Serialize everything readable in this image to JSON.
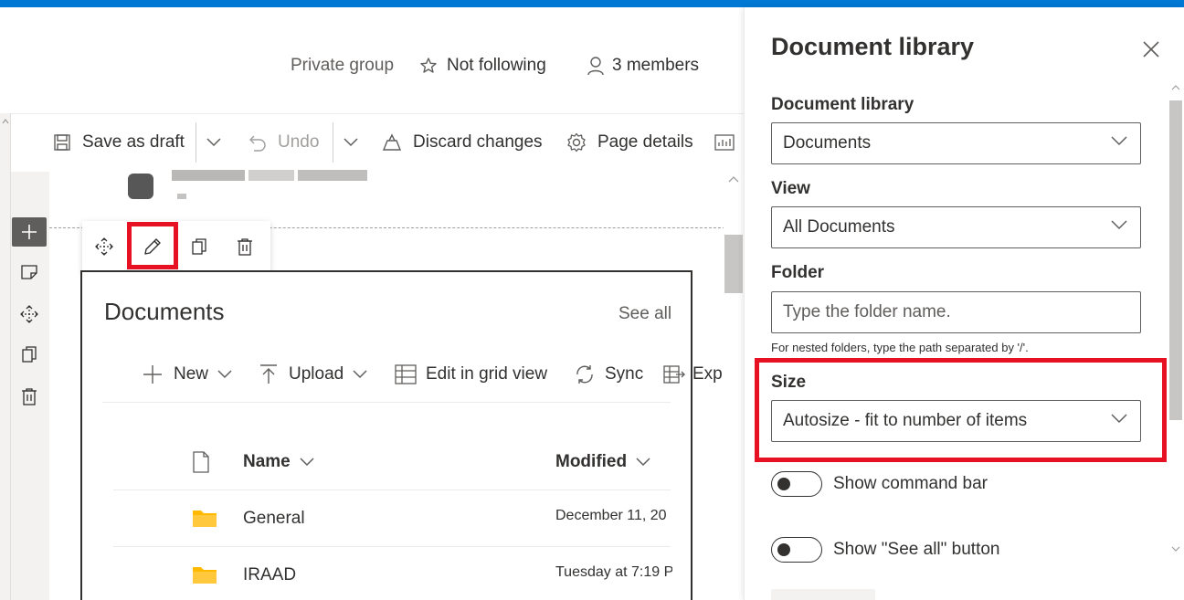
{
  "header": {
    "privacy": "Private group",
    "follow": "Not following",
    "members": "3 members"
  },
  "toolbar": {
    "save_draft": "Save as draft",
    "undo": "Undo",
    "discard": "Discard changes",
    "page_details": "Page details"
  },
  "webpart": {
    "title": "Documents",
    "see_all": "See all",
    "commands": {
      "new": "New",
      "upload": "Upload",
      "edit_grid": "Edit in grid view",
      "sync": "Sync",
      "export": "Exp"
    },
    "columns": {
      "name": "Name",
      "modified": "Modified"
    },
    "rows": [
      {
        "name": "General",
        "modified": "December 11, 20"
      },
      {
        "name": "IRAAD",
        "modified": "Tuesday at 7:19 P"
      }
    ]
  },
  "pane": {
    "title": "Document library",
    "library_label": "Document library",
    "library_value": "Documents",
    "view_label": "View",
    "view_value": "All Documents",
    "folder_label": "Folder",
    "folder_placeholder": "Type the folder name.",
    "folder_hint": "For nested folders, type the path separated by '/'.",
    "size_label": "Size",
    "size_value": "Autosize - fit to number of items",
    "toggle_command_bar": "Show command bar",
    "toggle_see_all": "Show \"See all\" button"
  },
  "colors": {
    "accent": "#0078d4",
    "highlight": "#e81123",
    "folder": "#ffb900"
  },
  "icons": [
    "star-icon",
    "person-icon",
    "save-icon",
    "undo-icon",
    "discard-icon",
    "gear-icon",
    "move-icon",
    "pencil-icon",
    "copy-icon",
    "trash-icon",
    "plus-icon",
    "upload-icon",
    "grid-icon",
    "sync-icon",
    "export-icon",
    "file-icon",
    "folder-icon",
    "close-icon",
    "chevron-down-icon"
  ]
}
